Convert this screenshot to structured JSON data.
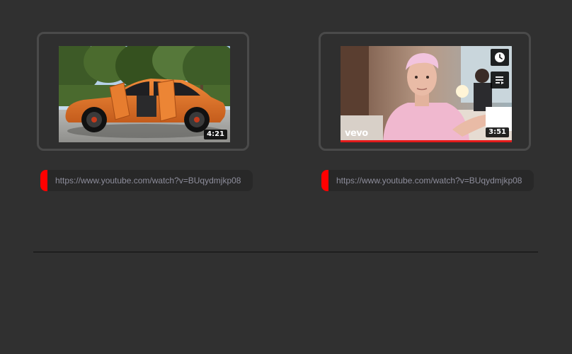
{
  "videos": [
    {
      "duration": "4:21",
      "url": "https://www.youtube.com/watch?v=BUqydmjkp08",
      "thumbnail": "orange-suv"
    },
    {
      "duration": "3:51",
      "url": "https://www.youtube.com/watch?v=BUqydmjkp08",
      "thumbnail": "man-pink-hoodie",
      "brand": "vevo",
      "watched_fraction": 1.0
    }
  ],
  "colors": {
    "background": "#303030",
    "card_border": "#4a4a4a",
    "url_bar": "#282828",
    "url_text": "#8d8d9b",
    "accent_red": "#ff0000",
    "divider": "#1e1e1e"
  },
  "icons": {
    "watch_later": "clock-icon",
    "add_to_queue": "queue-icon"
  }
}
